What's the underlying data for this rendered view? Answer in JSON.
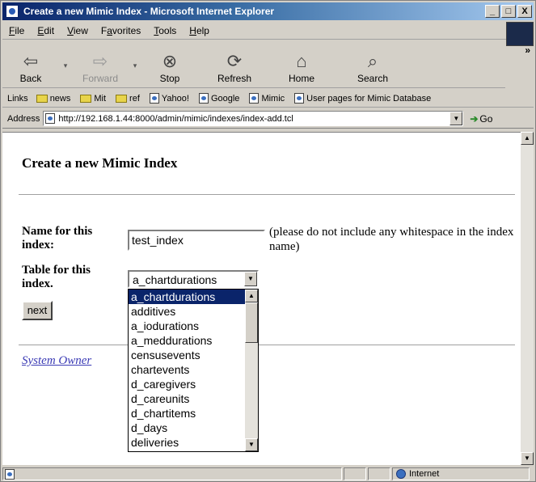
{
  "window": {
    "title": "Create a new Mimic Index - Microsoft Internet Explorer",
    "controls": [
      "_",
      "□",
      "X"
    ]
  },
  "menubar": {
    "items": [
      {
        "label": "File",
        "ul": "F",
        "rest": "ile"
      },
      {
        "label": "Edit",
        "ul": "E",
        "rest": "dit"
      },
      {
        "label": "View",
        "ul": "V",
        "rest": "iew"
      },
      {
        "label": "Favorites",
        "ul": "a",
        "pre": "F",
        "rest": "vorites"
      },
      {
        "label": "Tools",
        "ul": "T",
        "rest": "ools"
      },
      {
        "label": "Help",
        "ul": "H",
        "rest": "elp"
      }
    ]
  },
  "toolbar": {
    "back": "Back",
    "forward": "Forward",
    "stop": "Stop",
    "refresh": "Refresh",
    "home": "Home",
    "search": "Search",
    "more": "»"
  },
  "links": {
    "label": "Links",
    "items": [
      "news",
      "Mit",
      "ref",
      "Yahoo!",
      "Google",
      "Mimic",
      "User pages for Mimic Database"
    ]
  },
  "address": {
    "label": "Address",
    "url": "http://192.168.1.44:8000/admin/mimic/indexes/index-add.tcl",
    "go": "Go"
  },
  "page": {
    "title": "Create a new Mimic Index",
    "name_label": "Name for this index:",
    "name_value": "test_index",
    "name_hint": "(please do not include any whitespace in the index name)",
    "table_label": "Table for this index.",
    "table_selected": "a_chartdurations",
    "next_label": "next",
    "owner_link": "System Owner"
  },
  "table_options": [
    "a_chartdurations",
    "additives",
    "a_iodurations",
    "a_meddurations",
    "censusevents",
    "chartevents",
    "d_caregivers",
    "d_careunits",
    "d_chartitems",
    "d_days",
    "deliveries"
  ],
  "status": {
    "zone": "Internet"
  },
  "colors": {
    "title_bar": "#0a246a",
    "selection": "#0a246a",
    "link": "#3b3bb5"
  }
}
